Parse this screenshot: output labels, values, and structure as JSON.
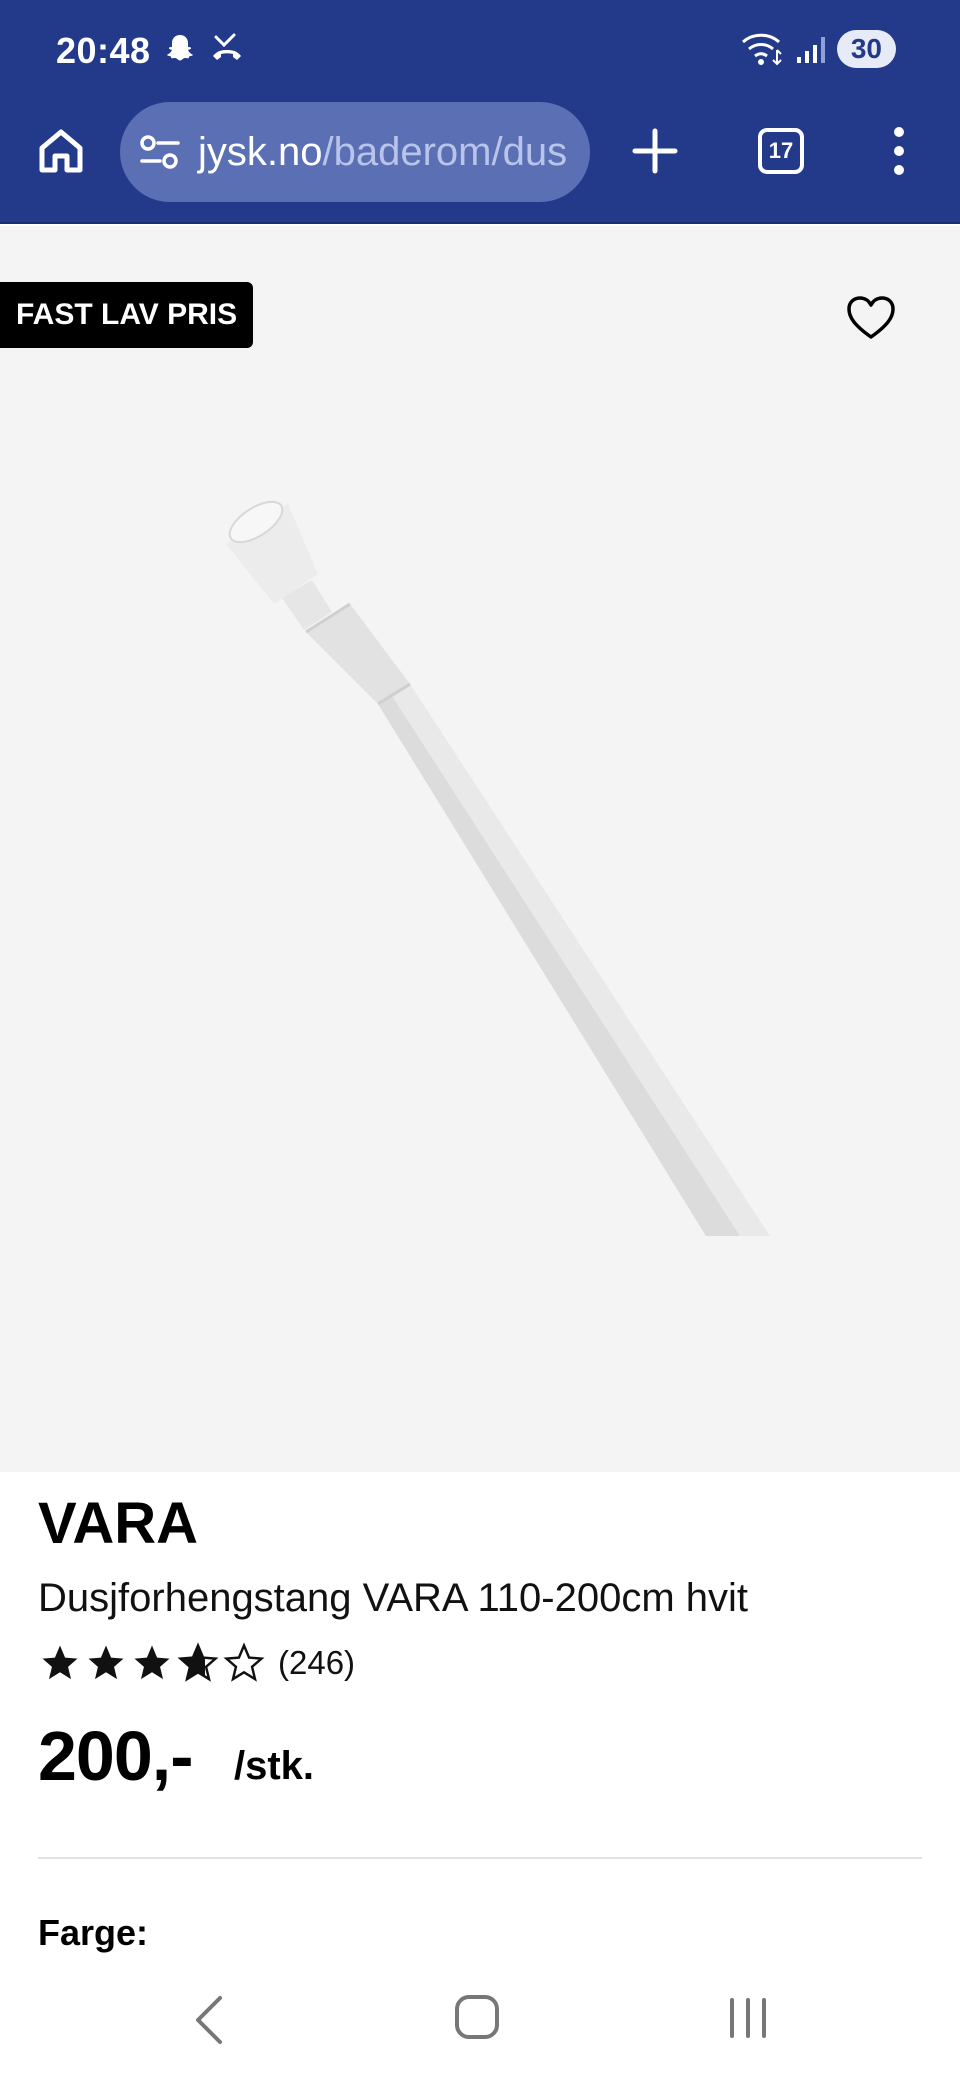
{
  "status_bar": {
    "time": "20:48",
    "battery": "30",
    "left_icons": [
      "snapchat-icon",
      "missed-call-icon"
    ],
    "right_icons": [
      "wifi-icon",
      "signal-icon",
      "battery-icon"
    ]
  },
  "browser": {
    "url_host": "jysk.no",
    "url_path": "/baderom/dus",
    "tab_count": "17",
    "icons": [
      "home-icon",
      "site-settings-icon",
      "plus-icon",
      "tabs-icon",
      "more-menu-icon"
    ]
  },
  "product": {
    "badge": "FAST LAV PRIS",
    "brand": "VARA",
    "name": "Dusjforhengstang VARA 110-200cm hvit",
    "rating": 3.7,
    "rating_max": 5,
    "review_count": "(246)",
    "price": "200,-",
    "price_unit": "/stk.",
    "color_label": "Farge:"
  },
  "colors": {
    "header_bg": "#233a8b",
    "url_bar_bg": "#5b6fb4",
    "image_bg": "#f4f4f4",
    "badge_bg": "#000000"
  },
  "nav": {
    "icons": [
      "back-icon",
      "home-circle-icon",
      "recent-apps-icon"
    ]
  }
}
